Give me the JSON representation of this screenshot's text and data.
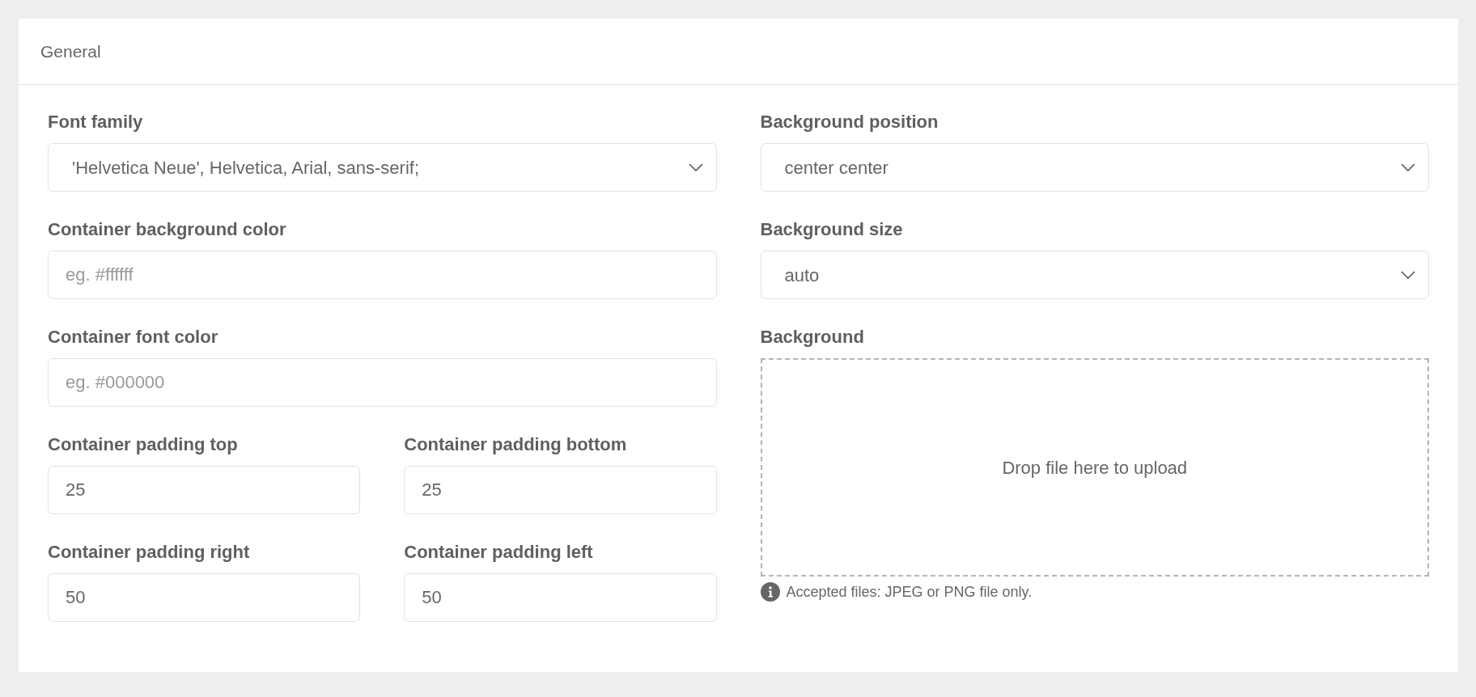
{
  "panel": {
    "title": "General"
  },
  "left_column": [
    {
      "kind": "select",
      "label": "Font family",
      "value": "'Helvetica Neue', Helvetica, Arial, sans-serif;"
    },
    {
      "kind": "text",
      "label": "Container background color",
      "placeholder": "eg. #ffffff"
    },
    {
      "kind": "text",
      "label": "Container font color",
      "placeholder": "eg. #000000"
    },
    {
      "kind": "pair",
      "fields": [
        {
          "kind": "text",
          "label": "Container padding top",
          "value": "25"
        },
        {
          "kind": "text",
          "label": "Container padding bottom",
          "value": "25"
        }
      ]
    },
    {
      "kind": "pair",
      "fields": [
        {
          "kind": "text",
          "label": "Container padding right",
          "value": "50"
        },
        {
          "kind": "text",
          "label": "Container padding left",
          "value": "50"
        }
      ]
    }
  ],
  "right_column": [
    {
      "kind": "select",
      "label": "Background position",
      "value": "center center"
    },
    {
      "kind": "select",
      "label": "Background size",
      "value": "auto"
    },
    {
      "kind": "upload",
      "label": "Background",
      "drop_text": "Drop file here to upload",
      "hint": "Accepted files: JPEG or PNG file only."
    }
  ]
}
